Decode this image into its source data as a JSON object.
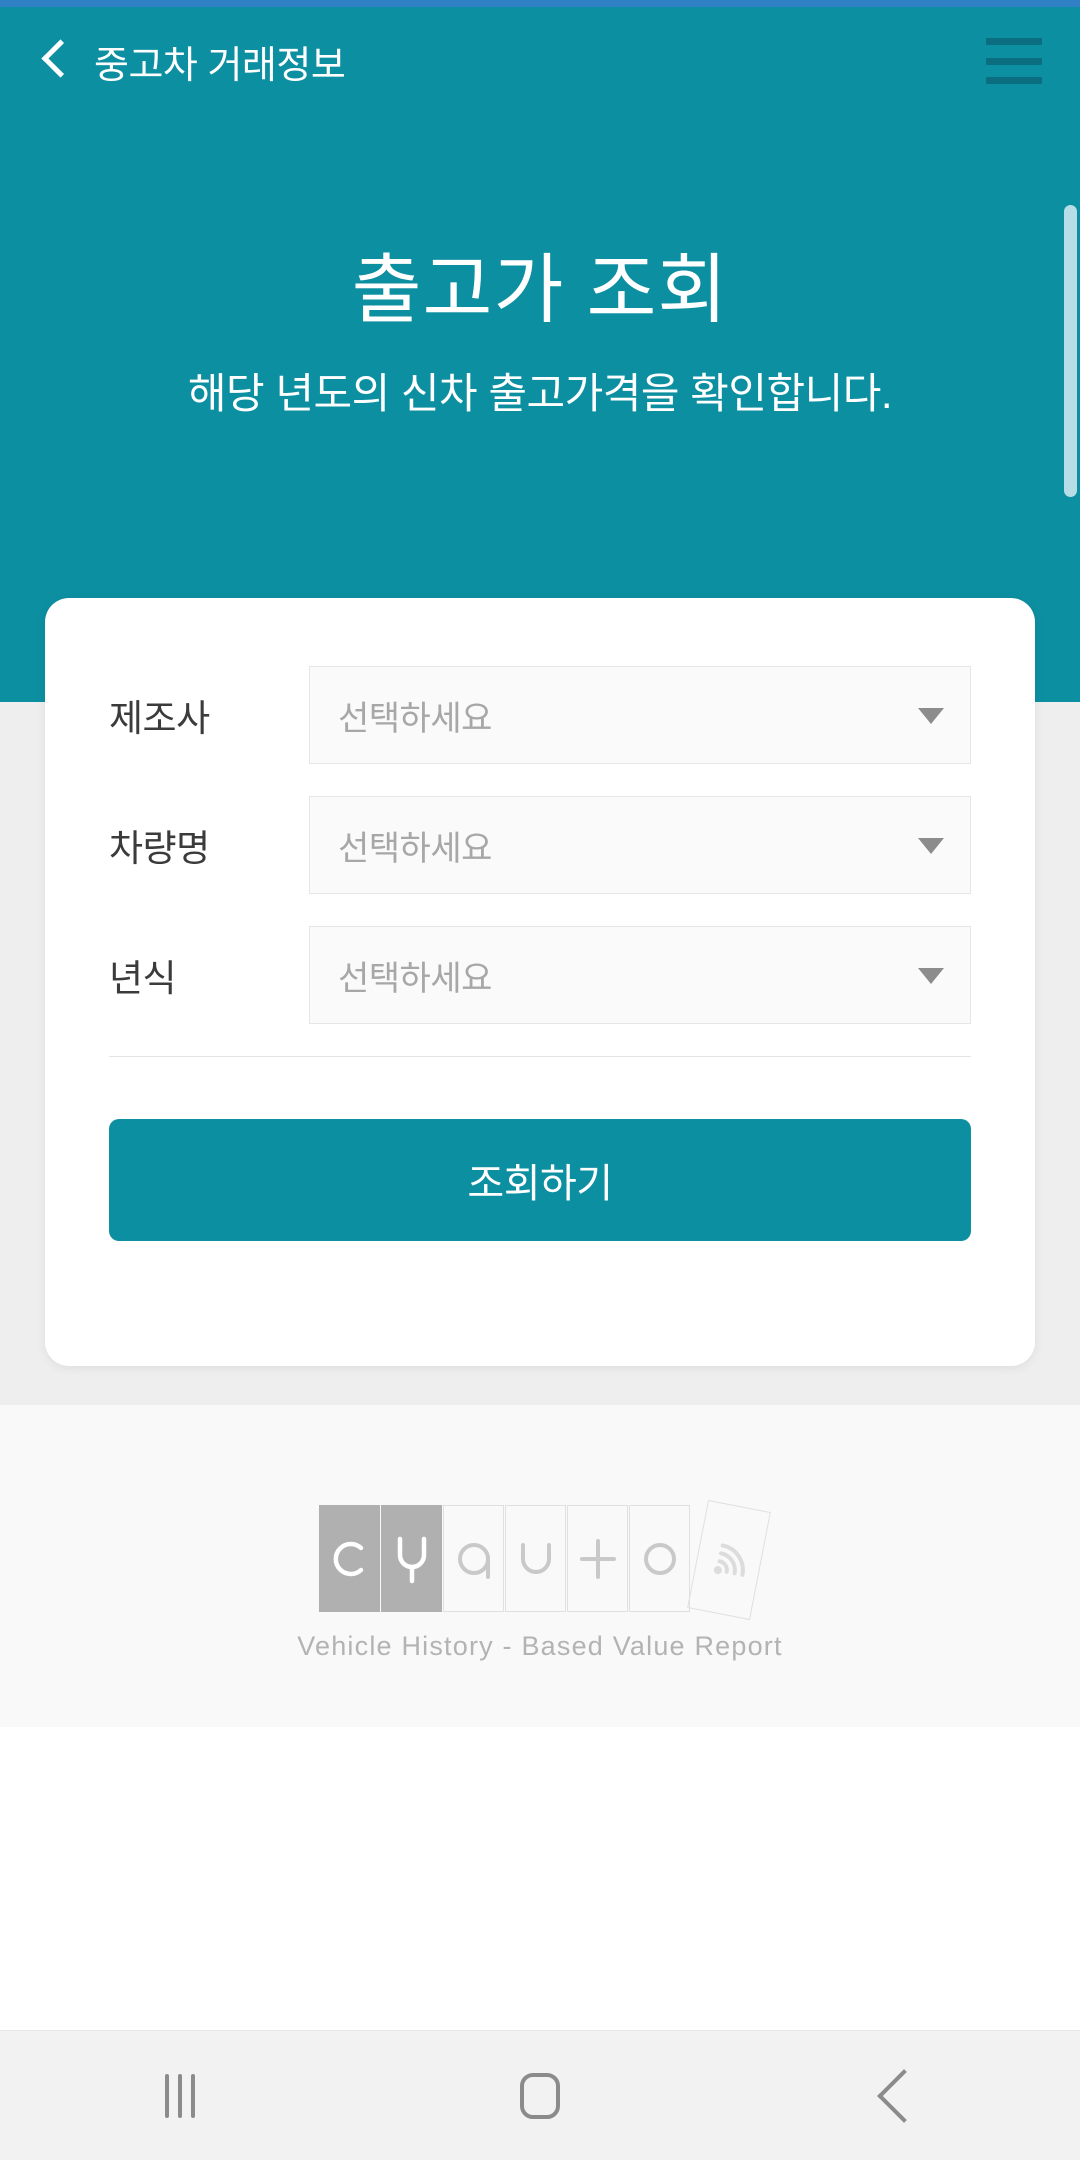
{
  "theme": {
    "accent": "#0d8fa2",
    "status_strip": "#2f80c4",
    "page_background": "#eeeeee",
    "footer_background": "#f9f9f9",
    "placeholder_text": "#a7a7a7"
  },
  "app_bar": {
    "back_icon": "back-chevron-icon",
    "title": "중고차 거래정보",
    "menu_icon": "hamburger-menu-icon"
  },
  "hero": {
    "title": "출고가 조회",
    "subtitle": "해당 년도의 신차 출고가격을 확인합니다."
  },
  "form": {
    "rows": [
      {
        "label": "제조사",
        "value": "선택하세요",
        "arrow_icon": "chevron-down-icon"
      },
      {
        "label": "차량명",
        "value": "선택하세요",
        "arrow_icon": "chevron-down-icon"
      },
      {
        "label": "년식",
        "value": "선택하세요",
        "arrow_icon": "chevron-down-icon"
      }
    ],
    "submit_label": "조회하기"
  },
  "footer": {
    "logo_letters": [
      "c",
      "y",
      "a",
      "u",
      "t",
      "o"
    ],
    "logo_name": "CYAUTO",
    "logo_badge_icon": "signal-wave-icon",
    "tagline": "Vehicle History - Based Value Report"
  },
  "system_nav": {
    "recents_icon": "recents-icon",
    "home_icon": "home-icon",
    "back_icon": "back-icon"
  }
}
